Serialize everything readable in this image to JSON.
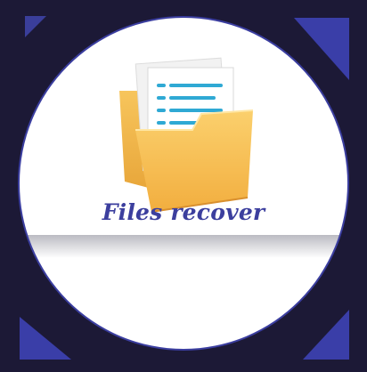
{
  "badge": {
    "caption": "Files recover",
    "icon": "folder-with-documents-icon"
  },
  "colors": {
    "background": "#1c1936",
    "accent": "#3c3f9e",
    "folder": "#f5b946",
    "paper_lines": "#2fa9d4"
  }
}
